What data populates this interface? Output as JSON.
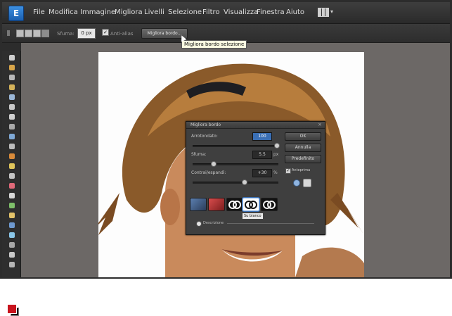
{
  "menu": {
    "app_icon": "E",
    "items": [
      "File",
      "Modifica",
      "Immagine",
      "Migliora",
      "Livelli",
      "Selezione",
      "Filtro",
      "Visualizza",
      "Finestra",
      "Aiuto"
    ],
    "workspace_icon": "workspace-layout-icon"
  },
  "options": {
    "feather_label": "Sfuma:",
    "feather_value": "0 px",
    "antialias_label": "Anti-alias",
    "antialias_checked": true,
    "refine_button": "Migliora bordo..."
  },
  "tooltip": "Migliora bordo selezione",
  "toolbox": {
    "foreground_color": "#c8141e",
    "background_color": "#000000"
  },
  "dialog": {
    "title": "Migliora bordo",
    "fields": [
      {
        "label": "Arrotondato:",
        "value": "100",
        "unit": "",
        "slider_fraction": 1.0
      },
      {
        "label": "Sfuma:",
        "value": "5.5",
        "unit": "px",
        "slider_fraction": 0.22
      },
      {
        "label": "Contrai/espandi:",
        "value": "+30",
        "unit": "%",
        "slider_fraction": 0.6
      }
    ],
    "buttons": {
      "ok": "OK",
      "cancel": "Annulla",
      "default": "Predefinito"
    },
    "preview_label": "Anteprima",
    "preview_checked": true,
    "thumb_tooltip": "Su bianco",
    "hint": "Descrizione"
  }
}
